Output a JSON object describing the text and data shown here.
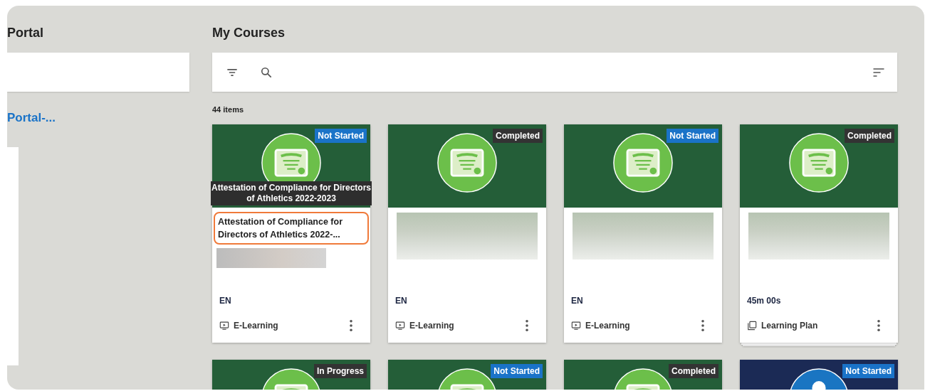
{
  "left_panel": {
    "heading": "Portal",
    "link": "Portal-..."
  },
  "main": {
    "heading": "My Courses",
    "item_count": "44 items"
  },
  "courses": [
    {
      "status": {
        "label": "Not Started",
        "kind": "todo"
      },
      "thumbnail": {
        "kind": "certificate"
      },
      "title": "Attestation of Compliance for Directors of Athletics 2022-...",
      "highlighted": true,
      "tooltip": "Attestation of Compliance for Directors of Athletics 2022-2023",
      "meta": "EN",
      "type": {
        "label": "E-Learning",
        "kind": "video"
      }
    },
    {
      "status": {
        "label": "Completed",
        "kind": "done"
      },
      "thumbnail": {
        "kind": "certificate"
      },
      "meta": "EN",
      "type": {
        "label": "E-Learning",
        "kind": "video"
      }
    },
    {
      "status": {
        "label": "Not Started",
        "kind": "todo"
      },
      "thumbnail": {
        "kind": "certificate"
      },
      "meta": "EN",
      "type": {
        "label": "E-Learning",
        "kind": "video"
      }
    },
    {
      "status": {
        "label": "Completed",
        "kind": "done"
      },
      "thumbnail": {
        "kind": "certificate"
      },
      "meta": "45m 00s",
      "type": {
        "label": "Learning Plan",
        "kind": "plan"
      }
    },
    {
      "status": {
        "label": "In Progress",
        "kind": "active"
      },
      "thumbnail": {
        "kind": "certificate"
      }
    },
    {
      "status": {
        "label": "Not Started",
        "kind": "todo"
      },
      "thumbnail": {
        "kind": "certificate"
      }
    },
    {
      "status": {
        "label": "Completed",
        "kind": "done"
      },
      "thumbnail": {
        "kind": "certificate"
      }
    },
    {
      "status": {
        "label": "Not Started",
        "kind": "todo"
      },
      "thumbnail": {
        "kind": "person"
      }
    }
  ]
}
